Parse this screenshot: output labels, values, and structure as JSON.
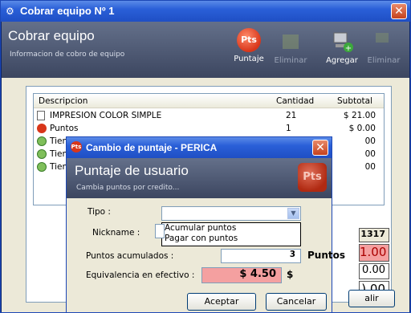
{
  "window": {
    "title": "Cobrar equipo Nº 1",
    "close": "✕"
  },
  "header": {
    "title": "Cobrar equipo",
    "subtitle": "Informacion de cobro de equipo"
  },
  "toolbar": {
    "puntaje": "Puntaje",
    "eliminar1": "Eliminar",
    "agregar": "Agregar",
    "eliminar2": "Eliminar",
    "pts_badge": "Pts"
  },
  "list": {
    "headers": {
      "descripcion": "Descripcion",
      "cantidad": "Cantidad",
      "subtotal": "Subtotal"
    },
    "rows": [
      {
        "desc": "IMPRESION COLOR SIMPLE",
        "qty": "21",
        "sub": "$ 21.00"
      },
      {
        "desc": "Puntos",
        "qty": "1",
        "sub": "$ 0.00"
      },
      {
        "desc": "Tiem",
        "qty": "",
        "sub": "00"
      },
      {
        "desc": "Tiem",
        "qty": "",
        "sub": "00"
      },
      {
        "desc": "Tiem",
        "qty": "",
        "sub": "00"
      }
    ]
  },
  "summary": {
    "box1": "1317",
    "box2": "1.00",
    "box3": "0.00",
    "box4": ").00",
    "salir": "alir"
  },
  "modal": {
    "title": "Cambio de puntaje - PERICA",
    "close": "✕",
    "heading": "Puntaje de usuario",
    "subheading": "Cambia puntos por credito...",
    "pts": "Pts",
    "tipo_label": "Tipo :",
    "tipo_value": "",
    "tipo_options": [
      "Acumular puntos",
      "Pagar con puntos"
    ],
    "nickname_label": "Nickname :",
    "puntos_label": "Puntos acumulados :",
    "puntos_value": "3",
    "puntos_unit": "Puntos",
    "equiv_label": "Equivalencia en efectivo :",
    "equiv_value": "$ 4.50",
    "equiv_unit": "$",
    "accept": "Aceptar",
    "cancel": "Cancelar"
  }
}
